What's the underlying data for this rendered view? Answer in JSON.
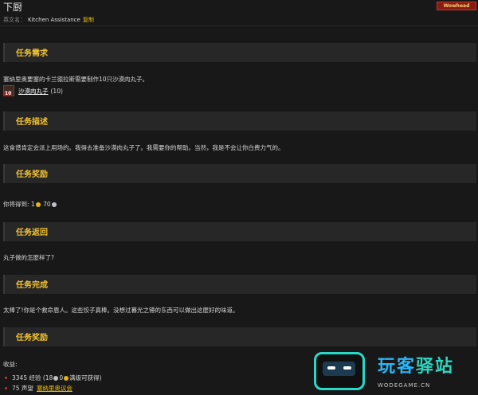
{
  "header": {
    "title": "下厨",
    "badge": "Wowhead",
    "english_name_label": "英文名：",
    "english_name": "Kitchen Assistance",
    "copy_label": "复制"
  },
  "sections": {
    "requirements": {
      "title": "任务需求",
      "text": "塞纳里奥要塞的卡兰德拉斯需要制作10只沙漠肉丸子。",
      "item_name": "沙漠肉丸子",
      "item_count": "(10)",
      "item_icon_qty": "10"
    },
    "description": {
      "title": "任务描述",
      "text": "这食谱肯定会派上用场的。我得去准备沙漠肉丸子了。我需要你的帮助。当然，我是不会让你白费力气的。"
    },
    "rewards": {
      "title": "任务奖励",
      "prefix": "你将得到: 1",
      "silver": "70"
    },
    "progress": {
      "title": "任务返回",
      "text": "丸子做的怎麽样了?"
    },
    "completion": {
      "title": "任务完成",
      "text": "太棒了!你是个救命恩人。这些饺子真棒。没想过暮光之锤的东西可以做出这麽好的味道。"
    },
    "gains": {
      "title": "任务奖励",
      "label": "收益:",
      "xp_line": "3345 经验 (18",
      "xp_tail": "0",
      "xp_note": "满级可获得)",
      "rep_line": "75 声望",
      "rep_faction": "塞纳里奥议会"
    }
  },
  "watermark": {
    "part1": "玩客",
    "part2": "驿站",
    "url": "WODEGAME.CN"
  },
  "colors": {
    "accent_gold": "#f1c232",
    "link_gold": "#f0c000",
    "badge_red": "#8a1b12",
    "watermark_teal": "#28d9c8"
  }
}
